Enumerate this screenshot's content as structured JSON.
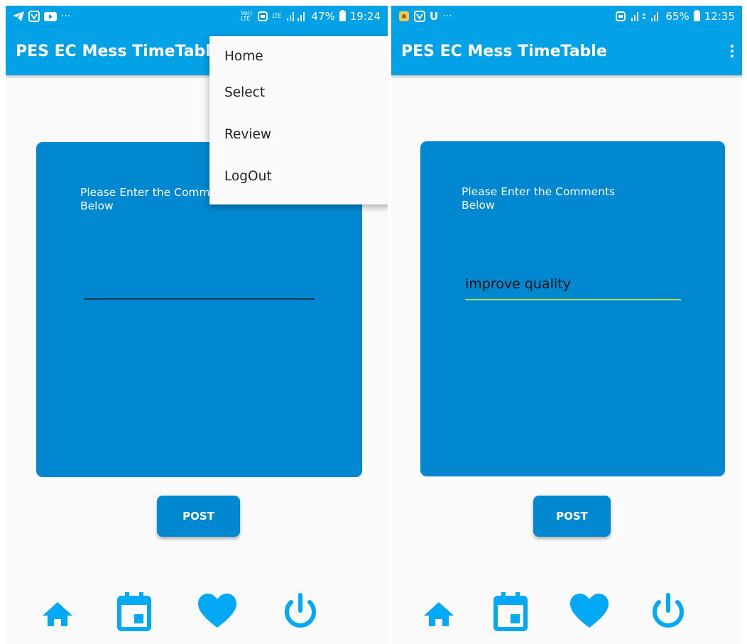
{
  "colors": {
    "primary": "#03a1e6",
    "card": "#0288d1",
    "nav_icon": "#03a9f4",
    "focus_underline": "#b8e04a"
  },
  "left_screen": {
    "status_bar": {
      "left_icons": [
        "telegram-icon",
        "app-icon",
        "youtube-icon",
        "more-icon"
      ],
      "more": "···",
      "network_labels": [
        "Vo)) LTE",
        "LTE"
      ],
      "battery": "47%",
      "time": "19:24"
    },
    "app_title": "PES EC Mess TimeTable",
    "card": {
      "prompt": "Please Enter the Comments Below",
      "input_value": ""
    },
    "post_button": "POST",
    "menu": {
      "items": [
        "Home",
        "Select",
        "Review",
        "LogOut"
      ]
    },
    "bottom_nav": [
      "home-icon",
      "calendar-icon",
      "heart-icon",
      "power-icon"
    ]
  },
  "right_screen": {
    "status_bar": {
      "left_icons": [
        "app-icon",
        "app-icon",
        "u-icon",
        "more-icon"
      ],
      "u": "U",
      "more": "···",
      "battery": "65%",
      "time": "12:35"
    },
    "app_title": "PES EC Mess TimeTable",
    "card": {
      "prompt": "Please Enter the Comments Below",
      "input_value": "improve quality"
    },
    "post_button": "POST",
    "bottom_nav": [
      "home-icon",
      "calendar-icon",
      "heart-icon",
      "power-icon"
    ]
  }
}
